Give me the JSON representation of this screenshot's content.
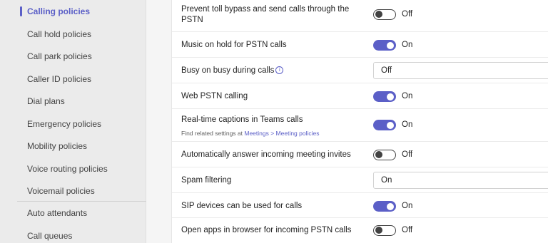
{
  "sidebar": {
    "items": [
      {
        "label": "Calling policies",
        "active": true
      },
      {
        "label": "Call hold policies",
        "active": false
      },
      {
        "label": "Call park policies",
        "active": false
      },
      {
        "label": "Caller ID policies",
        "active": false
      },
      {
        "label": "Dial plans",
        "active": false
      },
      {
        "label": "Emergency policies",
        "active": false
      },
      {
        "label": "Mobility policies",
        "active": false
      },
      {
        "label": "Voice routing policies",
        "active": false
      },
      {
        "label": "Voicemail policies",
        "active": false
      },
      {
        "label": "Auto attendants",
        "active": false
      },
      {
        "label": "Call queues",
        "active": false
      }
    ]
  },
  "settings": [
    {
      "label_line1": "Prevent toll bypass and send calls through the",
      "label_line2": "PSTN",
      "control": "toggle",
      "state": "off",
      "state_label": "Off"
    },
    {
      "label": "Music on hold for PSTN calls",
      "control": "toggle",
      "state": "on",
      "state_label": "On"
    },
    {
      "label": "Busy on busy during calls",
      "has_info_icon": true,
      "control": "select",
      "value": "Off"
    },
    {
      "label": "Web PSTN calling",
      "control": "toggle",
      "state": "on",
      "state_label": "On"
    },
    {
      "label": "Real-time captions in Teams calls",
      "sub_prefix": "Find related settings at ",
      "sub_link": "Meetings > Meeting policies",
      "control": "toggle",
      "state": "on",
      "state_label": "On"
    },
    {
      "label": "Automatically answer incoming meeting invites",
      "control": "toggle",
      "state": "off",
      "state_label": "Off"
    },
    {
      "label": "Spam filtering",
      "control": "select",
      "value": "On"
    },
    {
      "label": "SIP devices can be used for calls",
      "highlighted": true,
      "control": "toggle",
      "state": "on",
      "state_label": "On"
    },
    {
      "label": "Open apps in browser for incoming PSTN calls",
      "control": "toggle",
      "state": "off",
      "state_label": "Off"
    }
  ],
  "colors": {
    "accent": "#5b5fc7",
    "highlight": "#ffff1e",
    "sidebar_bg": "#ebebeb"
  },
  "icons": {
    "info": "info-icon"
  }
}
